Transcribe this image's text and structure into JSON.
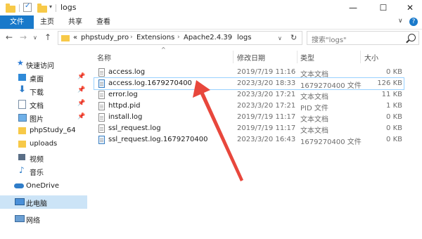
{
  "window": {
    "title": "logs",
    "minimize": "—",
    "maximize": "☐",
    "close": "✕"
  },
  "ribbon": {
    "tabs": [
      "文件",
      "主页",
      "共享",
      "查看"
    ],
    "expand": "∨",
    "help": "?"
  },
  "address": {
    "prefix": "«",
    "crumbs": [
      "phpstudy_pro",
      "Extensions",
      "Apache2.4.39",
      "logs"
    ],
    "dropdown": "∨",
    "refresh": "↻"
  },
  "search": {
    "placeholder": "搜索\"logs\""
  },
  "nav": {
    "items": [
      {
        "label": "快速访问",
        "icon": "star-icon",
        "pinned": false
      },
      {
        "label": "桌面",
        "icon": "desktop-icon",
        "pinned": true
      },
      {
        "label": "下载",
        "icon": "download-icon",
        "pinned": true
      },
      {
        "label": "文档",
        "icon": "document-icon",
        "pinned": true
      },
      {
        "label": "图片",
        "icon": "picture-icon",
        "pinned": true
      },
      {
        "label": "phpStudy_64",
        "icon": "folder-icon",
        "pinned": false
      },
      {
        "label": "uploads",
        "icon": "folder-icon",
        "pinned": false
      },
      {
        "label": "视频",
        "icon": "video-icon",
        "pinned": false
      },
      {
        "label": "音乐",
        "icon": "music-icon",
        "pinned": false
      },
      {
        "label": "OneDrive",
        "icon": "cloud-icon",
        "pinned": false
      },
      {
        "label": "此电脑",
        "icon": "computer-icon",
        "pinned": false
      },
      {
        "label": "网络",
        "icon": "network-icon",
        "pinned": false
      }
    ]
  },
  "columns": {
    "name": "名称",
    "date": "修改日期",
    "type": "类型",
    "size": "大小",
    "sort_indicator": "^"
  },
  "files": [
    {
      "name": "access.log",
      "date": "2019/7/19 11:16",
      "type": "文本文档",
      "size": "0 KB"
    },
    {
      "name": "access.log.1679270400",
      "date": "2023/3/20 18:33",
      "type": "1679270400 文件",
      "size": "126 KB"
    },
    {
      "name": "error.log",
      "date": "2023/3/20 17:21",
      "type": "文本文档",
      "size": "11 KB"
    },
    {
      "name": "httpd.pid",
      "date": "2023/3/20 17:21",
      "type": "PID 文件",
      "size": "1 KB"
    },
    {
      "name": "install.log",
      "date": "2019/7/19 11:17",
      "type": "文本文档",
      "size": "0 KB"
    },
    {
      "name": "ssl_request.log",
      "date": "2019/7/19 11:17",
      "type": "文本文档",
      "size": "0 KB"
    },
    {
      "name": "ssl_request.log.1679270400",
      "date": "2023/3/20 16:43",
      "type": "1679270400 文件",
      "size": "0 KB"
    }
  ],
  "annotation_color": "#e8473c",
  "accent_color": "#1979ca"
}
